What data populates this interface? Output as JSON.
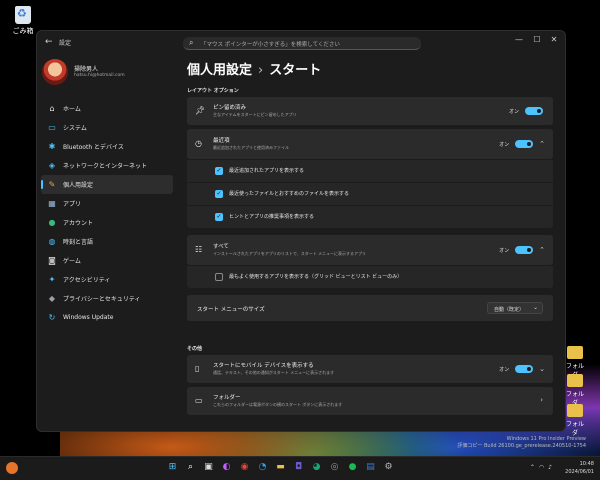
{
  "desktop": {
    "recycle_bin_label": "ごみ箱",
    "folders": [
      {
        "label": "フォルダ"
      },
      {
        "label": "フォルダ"
      },
      {
        "label": "フォルダ"
      }
    ],
    "watermark_line1": "Windows 11 Pro Insider Preview",
    "watermark_line2": "評価コピー Build 26100.ge_prerelease.240510-1754"
  },
  "window": {
    "title": "設定",
    "controls": {
      "minimize": "—",
      "maximize": "☐",
      "close": "✕"
    },
    "search_placeholder": "「マウス ポインターが小さすぎる」を検索してください"
  },
  "user": {
    "name": "掃除男人",
    "email": "hatsu.hi@hotmail.com"
  },
  "nav": {
    "items": [
      {
        "label": "ホーム",
        "icon": "home-icon",
        "glyph": "⌂"
      },
      {
        "label": "システム",
        "icon": "monitor-icon",
        "glyph": "▭"
      },
      {
        "label": "Bluetooth とデバイス",
        "icon": "bluetooth-icon",
        "glyph": "✱"
      },
      {
        "label": "ネットワークとインターネット",
        "icon": "wifi-icon",
        "glyph": "◈"
      },
      {
        "label": "個人用設定",
        "icon": "brush-icon",
        "glyph": "✎"
      },
      {
        "label": "アプリ",
        "icon": "apps-icon",
        "glyph": "▦"
      },
      {
        "label": "アカウント",
        "icon": "account-icon",
        "glyph": "●"
      },
      {
        "label": "時刻と言語",
        "icon": "globe-icon",
        "glyph": "◍"
      },
      {
        "label": "ゲーム",
        "icon": "gamepad-icon",
        "glyph": "◙"
      },
      {
        "label": "アクセシビリティ",
        "icon": "accessibility-icon",
        "glyph": "✦"
      },
      {
        "label": "プライバシーとセキュリティ",
        "icon": "shield-icon",
        "glyph": "◆"
      },
      {
        "label": "Windows Update",
        "icon": "update-icon",
        "glyph": "↻"
      }
    ],
    "active_index": 4
  },
  "main": {
    "breadcrumb_parent": "個人用設定",
    "breadcrumb_sep": "›",
    "breadcrumb_current": "スタート",
    "section_layout": "レイアウト オプション",
    "section_other": "その他",
    "pinned": {
      "title": "ピン留め済み",
      "subtitle": "主なアイテムをスタートにピン留めしたアプリ",
      "toggle": "オン"
    },
    "recent": {
      "title": "最近項",
      "subtitle": "最近追加されたアプリと使用済みファイル",
      "toggle": "オン",
      "checks": [
        {
          "label": "最近追加されたアプリを表示する",
          "checked": true
        },
        {
          "label": "最近使ったファイルとおすすめのファイルを表示する",
          "checked": true
        },
        {
          "label": "ヒントとアプリの推奨事項を表示する",
          "checked": true
        }
      ]
    },
    "all_apps": {
      "title": "すべて",
      "subtitle": "インストールされたアプリをアプリのリストで、スタート メニューに表示するアプリ",
      "toggle": "オン",
      "check": {
        "label": "最もよく使用するアプリを表示する（グリッド ビューとリスト ビューのみ）",
        "checked": false
      }
    },
    "menu_size": {
      "title": "スタート メニューのサイズ",
      "value": "自動（既定）"
    },
    "mobile": {
      "title": "スタートにモバイル デバイスを表示する",
      "subtitle": "通話、テキスト、その他の通知がスタート メニューに表示されます",
      "toggle": "オン"
    },
    "folders": {
      "title": "フォルダー",
      "subtitle": "これらのフォルダーは電源ボタンの横のスタート ボタンに表示されます"
    }
  },
  "taskbar": {
    "time": "10:48",
    "date": "2024/06/01",
    "icons": [
      {
        "name": "start-icon",
        "glyph": "⊞",
        "color": "#4cc2ff"
      },
      {
        "name": "search-icon",
        "glyph": "⌕",
        "color": "#ffffff"
      },
      {
        "name": "task-view-icon",
        "glyph": "▣",
        "color": "#dddddd"
      },
      {
        "name": "copilot-icon",
        "glyph": "◐",
        "color": "#c45cff"
      },
      {
        "name": "chrome-icon",
        "glyph": "◉",
        "color": "#e8453c"
      },
      {
        "name": "edge-icon",
        "glyph": "◔",
        "color": "#34a0e0"
      },
      {
        "name": "explorer-icon",
        "glyph": "▬",
        "color": "#e8c04a"
      },
      {
        "name": "teams-icon",
        "glyph": "◘",
        "color": "#6a5acd"
      },
      {
        "name": "edge-dev-icon",
        "glyph": "◕",
        "color": "#1aa37a"
      },
      {
        "name": "app-icon",
        "glyph": "◎",
        "color": "#9a9a9a"
      },
      {
        "name": "spotify-icon",
        "glyph": "●",
        "color": "#1db954"
      },
      {
        "name": "store-icon",
        "glyph": "▤",
        "color": "#3a7bd5"
      },
      {
        "name": "settings-icon",
        "glyph": "⚙",
        "color": "#bbbbbb"
      }
    ]
  }
}
